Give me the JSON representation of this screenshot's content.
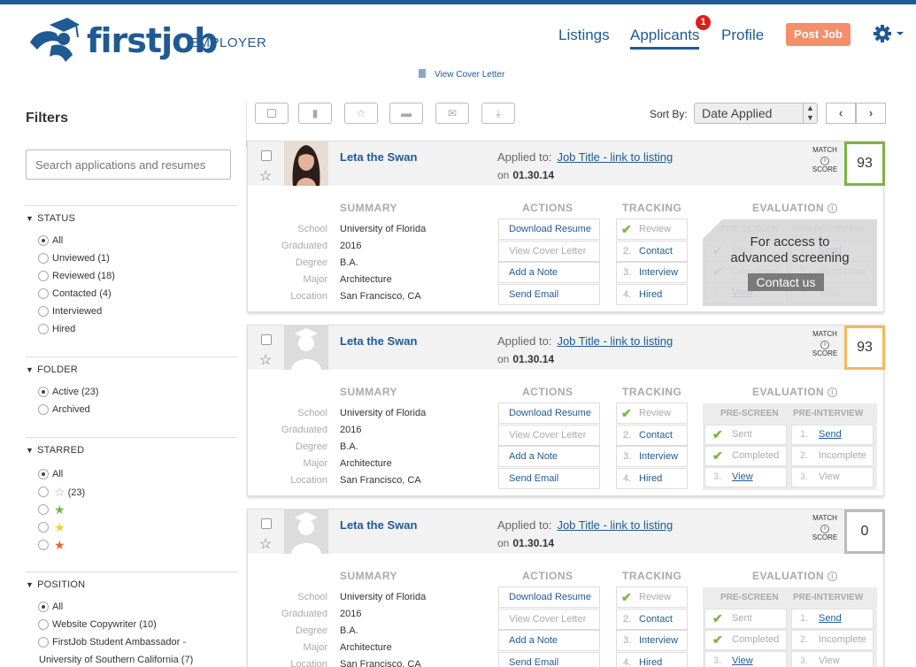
{
  "header": {
    "logo_text": "firstjob",
    "logo_sub": "EMPLOYER",
    "nav": {
      "listings": "Listings",
      "applicants": "Applicants",
      "applicants_badge": "1",
      "profile": "Profile"
    },
    "post_job": "Post Job",
    "view_cover_letter": "View Cover Letter"
  },
  "filters": {
    "title": "Filters",
    "search_placeholder": "Search applications and resumes",
    "status": {
      "title": "STATUS",
      "options": [
        "All",
        "Unviewed (1)",
        "Reviewed (18)",
        "Contacted (4)",
        "Interviewed",
        "Hired"
      ],
      "selected": 0
    },
    "folder": {
      "title": "FOLDER",
      "options": [
        "Active (23)",
        "Archived"
      ],
      "selected": 0
    },
    "starred": {
      "title": "STARRED",
      "all_label": "All",
      "empty_count": "(23)",
      "colors": [
        "#7bb442",
        "#f2cf2a",
        "#e8663d"
      ]
    },
    "position": {
      "title": "POSITION",
      "options": [
        "All",
        "Website Copywriter (10)",
        "FirstJob Student Ambassador -",
        "University of Southern California (7)"
      ]
    }
  },
  "toolbar": {
    "sort_label": "Sort By:",
    "sort_value": "Date Applied"
  },
  "labels": {
    "applied_to": "Applied to:",
    "on": "on",
    "match": "MATCH",
    "score": "SCORE",
    "summary": "SUMMARY",
    "actions": "ACTIONS",
    "tracking": "TRACKING",
    "evaluation": "EVALUATION",
    "pre_screen": "PRE-SCREEN",
    "pre_interview": "PRE-INTERVIEW",
    "school": "School",
    "graduated": "Graduated",
    "degree": "Degree",
    "major": "Major",
    "location": "Location",
    "download_resume": "Download Resume",
    "view_cover_letter": "View Cover Letter",
    "add_note": "Add a Note",
    "send_email": "Send Email",
    "review": "Review",
    "contact": "Contact",
    "interview": "Interview",
    "hired": "Hired",
    "sent": "Sent",
    "completed": "Completed",
    "view": "View",
    "send": "Send",
    "incomplete": "Incomplete",
    "overlay_line1": "For access to",
    "overlay_line2": "advanced screening",
    "contact_us": "Contact us"
  },
  "applicants": [
    {
      "name": "Leta the Swan",
      "job_title": "Job Title - link to listing",
      "date": "01.30.14",
      "score": "93",
      "score_color": "#7bb442",
      "school": "University of Florida",
      "graduated": "2016",
      "degree": "B.A.",
      "major": "Architecture",
      "location": "San Francisco, CA"
    },
    {
      "name": "Leta the Swan",
      "job_title": "Job Title - link to listing",
      "date": "01.30.14",
      "score": "93",
      "score_color": "#f5b85c",
      "school": "University of Florida",
      "graduated": "2016",
      "degree": "B.A.",
      "major": "Architecture",
      "location": "San Francisco, CA"
    },
    {
      "name": "Leta the Swan",
      "job_title": "Job Title - link to listing",
      "date": "01.30.14",
      "score": "0",
      "score_color": "#bbbbbb",
      "school": "University of Florida",
      "graduated": "2016",
      "degree": "B.A.",
      "major": "Architecture",
      "location": "San Francisco, CA"
    }
  ]
}
